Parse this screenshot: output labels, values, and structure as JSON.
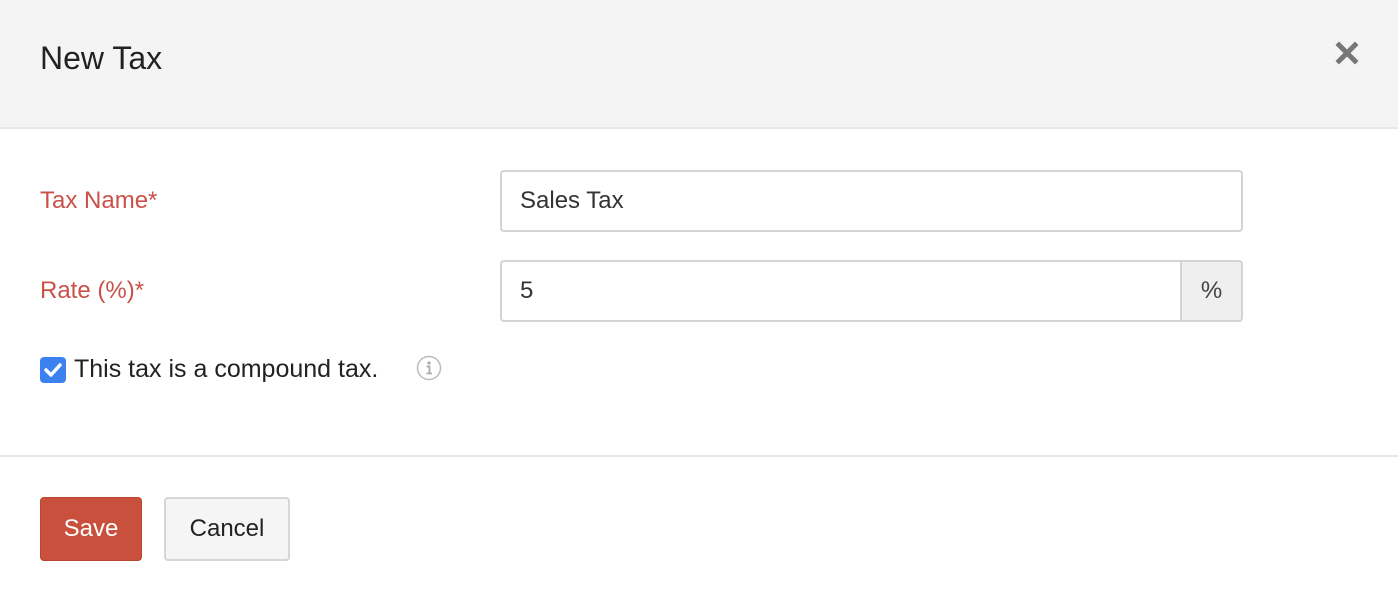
{
  "dialog": {
    "title": "New Tax",
    "close_icon": "close-icon"
  },
  "form": {
    "tax_name": {
      "label": "Tax Name*",
      "value": "Sales Tax"
    },
    "rate": {
      "label": "Rate (%)*",
      "value": "5",
      "suffix": "%"
    },
    "compound": {
      "label": "This tax is a compound tax.",
      "checked": true,
      "info_icon": "info-icon"
    }
  },
  "footer": {
    "save_label": "Save",
    "cancel_label": "Cancel"
  },
  "colors": {
    "label": "#c9514a",
    "save_button": "#c9503c",
    "checkbox": "#3b82f0"
  }
}
